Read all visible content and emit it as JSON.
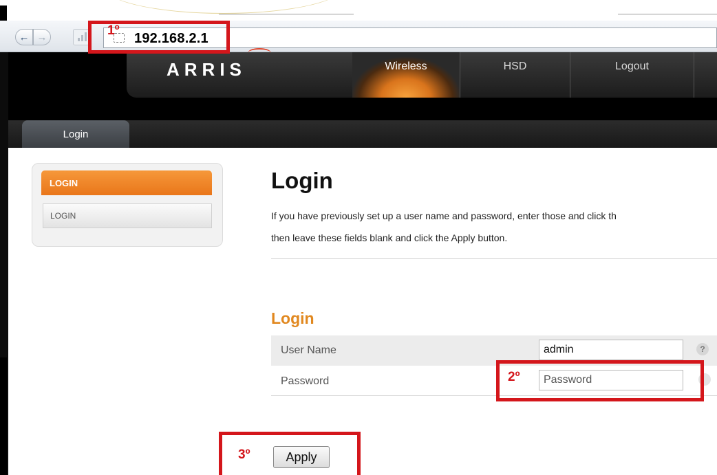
{
  "browser": {
    "url": "192.168.2.1",
    "back_icon": "←",
    "forward_icon": "→"
  },
  "router": {
    "logo": "ARRIS",
    "nav": [
      "Wireless",
      "HSD",
      "Logout"
    ],
    "active_nav": "Wireless",
    "tab": "Login",
    "accent_color": "#e9761a"
  },
  "sidebar": {
    "header": "LOGIN",
    "items": [
      "LOGIN"
    ]
  },
  "main": {
    "title": "Login",
    "desc_line1": "If you have previously set up a user name and password, enter those and click th",
    "desc_line2": "then leave these fields blank and click the Apply button.",
    "form_title": "Login",
    "username_label": "User Name",
    "username_value": "admin",
    "password_label": "Password",
    "password_placeholder": "Password",
    "help_glyph": "?",
    "apply_label": "Apply"
  },
  "annotations": {
    "step1": "1º",
    "step2": "2º",
    "step3": "3º",
    "color": "#d4161b"
  }
}
